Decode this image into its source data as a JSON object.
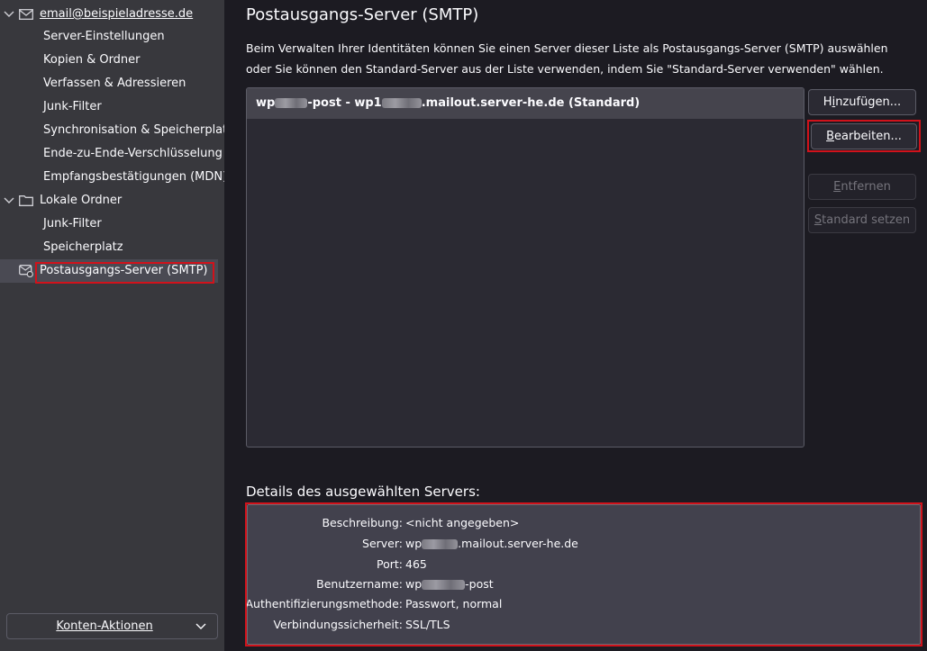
{
  "sidebar": {
    "account": {
      "label": "email@beispieladresse.de"
    },
    "account_children": [
      {
        "label": "Server-Einstellungen"
      },
      {
        "label": "Kopien & Ordner"
      },
      {
        "label": "Verfassen & Adressieren"
      },
      {
        "label": "Junk-Filter"
      },
      {
        "label": "Synchronisation & Speicherplatz"
      },
      {
        "label": "Ende-zu-Ende-Verschlüsselung"
      },
      {
        "label": "Empfangsbestätigungen (MDN)"
      }
    ],
    "local_folders": {
      "label": "Lokale Ordner"
    },
    "local_children": [
      {
        "label": "Junk-Filter"
      },
      {
        "label": "Speicherplatz"
      }
    ],
    "smtp": {
      "label": "Postausgangs-Server (SMTP)"
    },
    "account_actions": {
      "label": "Konten-Aktionen"
    }
  },
  "main": {
    "title": "Postausgangs-Server (SMTP)",
    "description": "Beim Verwalten Ihrer Identitäten können Sie einen Server dieser Liste als Postausgangs-Server (SMTP) auswählen oder Sie können den Standard-Server aus der Liste verwenden, indem Sie \"Standard-Server verwenden\" wählen.",
    "server_row": {
      "part1": "wp",
      "part2": "-post - wp1",
      "part3": ".mailout.server-he.de (Standard)"
    },
    "buttons": {
      "add": {
        "pre": "H",
        "key": "i",
        "post": "nzufügen..."
      },
      "edit": {
        "pre": "",
        "key": "B",
        "post": "earbeiten..."
      },
      "remove": {
        "pre": "",
        "key": "E",
        "post": "ntfernen"
      },
      "set_default": {
        "pre": "",
        "key": "S",
        "post": "tandard setzen"
      }
    },
    "details_heading": "Details des ausgewählten Servers:",
    "details": {
      "description": {
        "label": "Beschreibung:",
        "value": "<nicht angegeben>"
      },
      "server": {
        "label": "Server:",
        "value_pre": "wp",
        "value_post": ".mailout.server-he.de"
      },
      "port": {
        "label": "Port:",
        "value": "465"
      },
      "username": {
        "label": "Benutzername:",
        "value_pre": "wp",
        "value_post": "-post"
      },
      "auth": {
        "label": "Authentifizierungsmethode:",
        "value": "Passwort, normal"
      },
      "security": {
        "label": "Verbindungssicherheit:",
        "value": "SSL/TLS"
      }
    }
  },
  "colors": {
    "highlight_outline": "#d1121b",
    "sidebar_bg": "#38383d",
    "main_bg": "#1c1b22"
  }
}
